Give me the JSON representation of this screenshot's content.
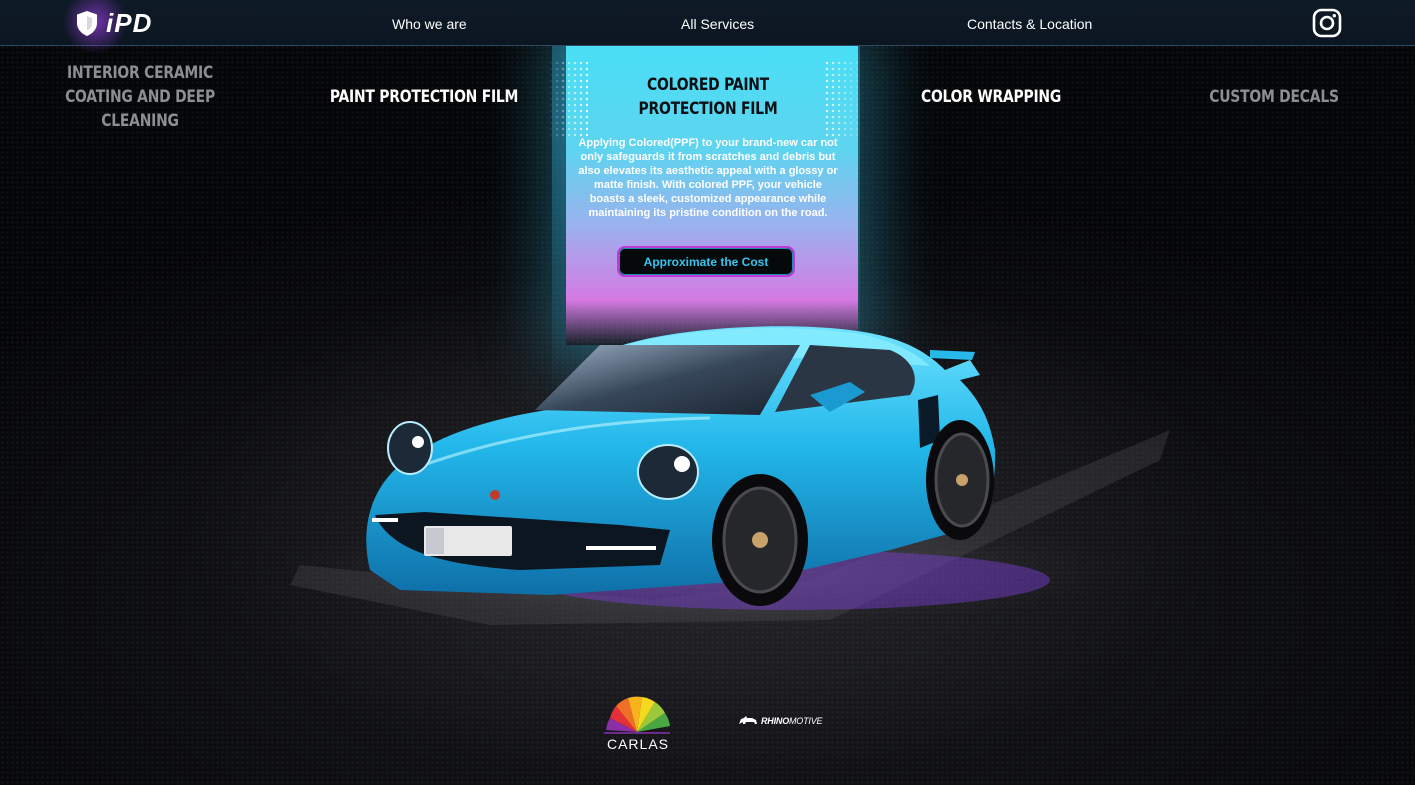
{
  "header": {
    "logo_text": "iPD",
    "nav": {
      "who_we_are": "Who we are",
      "all_services": "All Services",
      "contacts": "Contacts & Location"
    },
    "social_icon": "instagram-icon"
  },
  "services": {
    "interior": "INTERIOR CERAMIC COATING AND DEEP CLEANING",
    "ppf": "PAINT PROTECTION FILM",
    "colored_ppf": "COLORED PAINT PROTECTION FILM",
    "wrapping": "COLOR WRAPPING",
    "decals": "CUSTOM DECALS"
  },
  "active_service": {
    "description": "Applying Colored(PPF) to your brand-new car not only safeguards it from scratches and debris but also elevates its aesthetic appeal with a glossy or matte finish. With colored PPF, your vehicle boasts a sleek, customized appearance while maintaining its pristine condition on the road.",
    "cta_label": "Approximate the Cost"
  },
  "partners": {
    "carlas": "CARLAS",
    "rhino_bold": "RHINO",
    "rhino_light": "MOTIVE"
  },
  "colors": {
    "accent_cyan": "#35c6ec",
    "accent_purple": "#bb3ad8",
    "car_blue": "#21b8ea"
  }
}
